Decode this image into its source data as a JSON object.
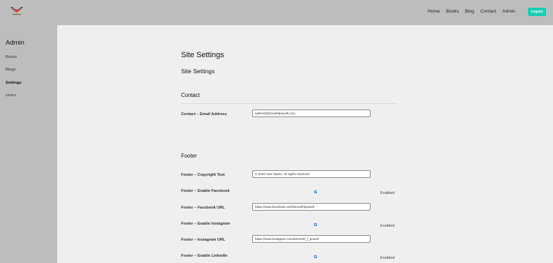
{
  "nav": {
    "home": "Home",
    "books": "Books",
    "blog": "Blog",
    "contact": "Contact",
    "admin": "Admin",
    "logout": "Logout"
  },
  "sidebar": {
    "title": "Admin",
    "items": [
      "Books",
      "Blogs",
      "Settings",
      "Users"
    ],
    "active": "Settings"
  },
  "page": {
    "title": "Site Settings",
    "subtitle": "Site Settings"
  },
  "contact": {
    "heading": "Contact",
    "email_label": "Contact – Email Address",
    "email_value": "author@kennethlpowell.com"
  },
  "footer": {
    "heading": "Footer",
    "copyright_label": "Footer – Copyright Text",
    "copyright_value": "© 2026 Your Name. All rights reserved.",
    "facebook_enable_label": "Footer – Enable Facebook",
    "facebook_enabled_text": "Enabled",
    "facebook_url_label": "Footer – Facebook URL",
    "facebook_url_value": "https://www.facebook.com/kennethlpowell",
    "instagram_enable_label": "Footer – Enable Instagram",
    "instagram_enabled_text": "Enabled",
    "instagram_url_label": "Footer – Instagram URL",
    "instagram_url_value": "https://www.instagram.com/kenneth_l_powell",
    "linkedin_enable_label": "Footer – Enable LinkedIn",
    "linkedin_enabled_text": "Enabled"
  },
  "colors": {
    "accent": "#18cdb4",
    "checkbox": "#1a73e8",
    "chrome": "#bdbdbd",
    "content_bg": "#efefef"
  }
}
